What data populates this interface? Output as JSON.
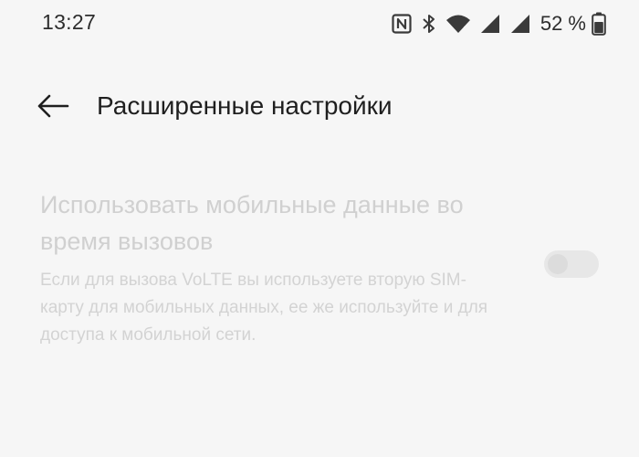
{
  "status_bar": {
    "time": "13:27",
    "battery_percent": "52 %",
    "icons": [
      "nfc-icon",
      "bluetooth-icon",
      "wifi-icon",
      "cell-signal-icon",
      "cell-signal-icon",
      "battery-icon"
    ]
  },
  "header": {
    "back_icon": "arrow-left-icon",
    "title": "Расширенные настройки"
  },
  "setting": {
    "title": "Использовать мобильные данные во время вызовов",
    "description": "Если для вызова VoLTE вы используете вторую SIM-карту для мобильных данных, ее же используйте и для доступа к мобильной сети.",
    "enabled": false,
    "toggle_on": false
  },
  "colors": {
    "background": "#f6f6f6",
    "text_primary": "#1f1f1f",
    "text_disabled": "#d0d0d0"
  }
}
